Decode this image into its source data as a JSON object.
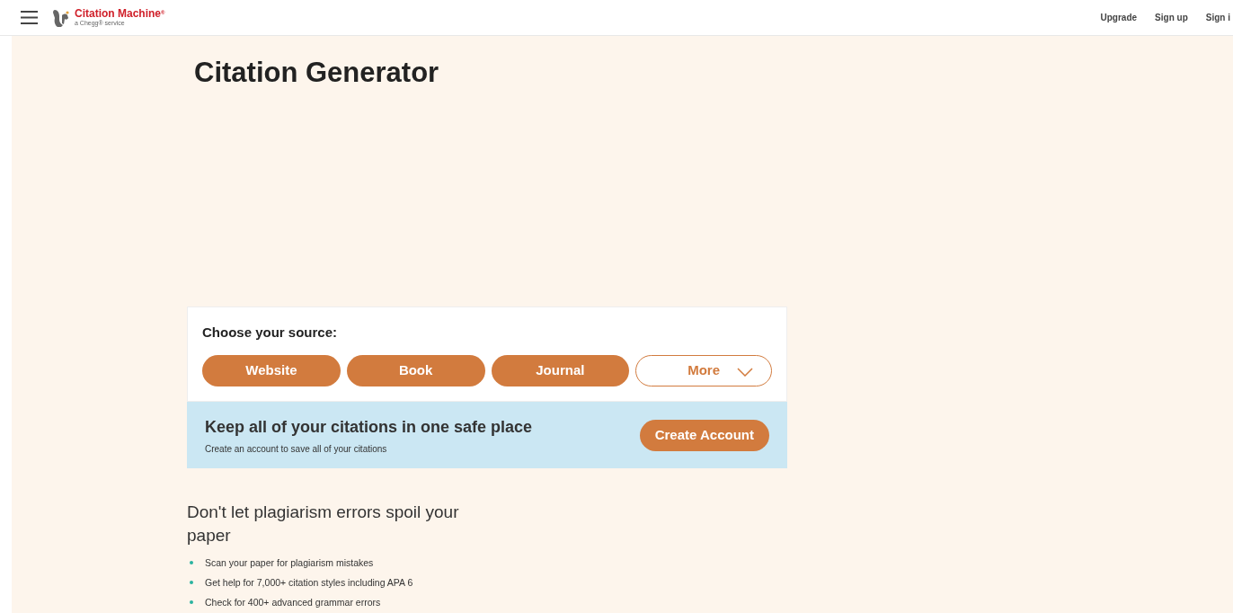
{
  "header": {
    "logo": {
      "name": "Citation Machine",
      "registered": "®",
      "tagline": "a Chegg® service"
    },
    "nav": [
      "Upgrade",
      "Sign up",
      "Sign i"
    ]
  },
  "title": "Citation Generator",
  "source_panel": {
    "label": "Choose your source:",
    "buttons": [
      {
        "label": "Website",
        "kind": "filled"
      },
      {
        "label": "Book",
        "kind": "filled"
      },
      {
        "label": "Journal",
        "kind": "filled"
      },
      {
        "label": "More",
        "kind": "dropdown"
      }
    ]
  },
  "account_banner": {
    "heading": "Keep all of your citations in one safe place",
    "subtext": "Create an account to save all of your citations",
    "button": "Create Account"
  },
  "plagiarism": {
    "heading": "Don't let plagiarism errors spoil your paper",
    "items": [
      "Scan your paper for plagiarism mistakes",
      "Get help for 7,000+ citation styles including APA 6",
      "Check for 400+ advanced grammar errors"
    ]
  }
}
